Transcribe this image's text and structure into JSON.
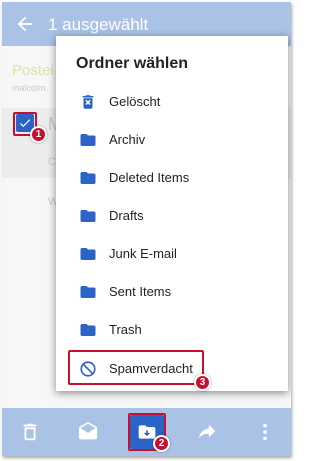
{
  "app_bar": {
    "title": "1 ausgewählt"
  },
  "background_list": {
    "folder_label": "Postei",
    "account_label": "malcolm.",
    "row_sender": "M",
    "row_preview": "C",
    "row_more": "W"
  },
  "dialog": {
    "title": "Ordner wählen",
    "folders": [
      {
        "label": "Gelöscht",
        "icon": "trash-icon"
      },
      {
        "label": "Archiv",
        "icon": "folder-icon"
      },
      {
        "label": "Deleted Items",
        "icon": "folder-icon"
      },
      {
        "label": "Drafts",
        "icon": "folder-icon"
      },
      {
        "label": "Junk E-mail",
        "icon": "folder-icon"
      },
      {
        "label": "Sent Items",
        "icon": "folder-icon"
      },
      {
        "label": "Trash",
        "icon": "folder-icon"
      },
      {
        "label": "Spamverdacht",
        "icon": "blocked-icon"
      }
    ]
  },
  "bottom_bar": {
    "buttons": [
      "delete",
      "mark-read",
      "move-to-folder",
      "forward",
      "more"
    ]
  },
  "callouts": {
    "step1": "1",
    "step2": "2",
    "step3": "3"
  },
  "colors": {
    "app_bar": "#a9c2e6",
    "accent_blue": "#2b63c7",
    "callout_red": "#c8102e"
  }
}
